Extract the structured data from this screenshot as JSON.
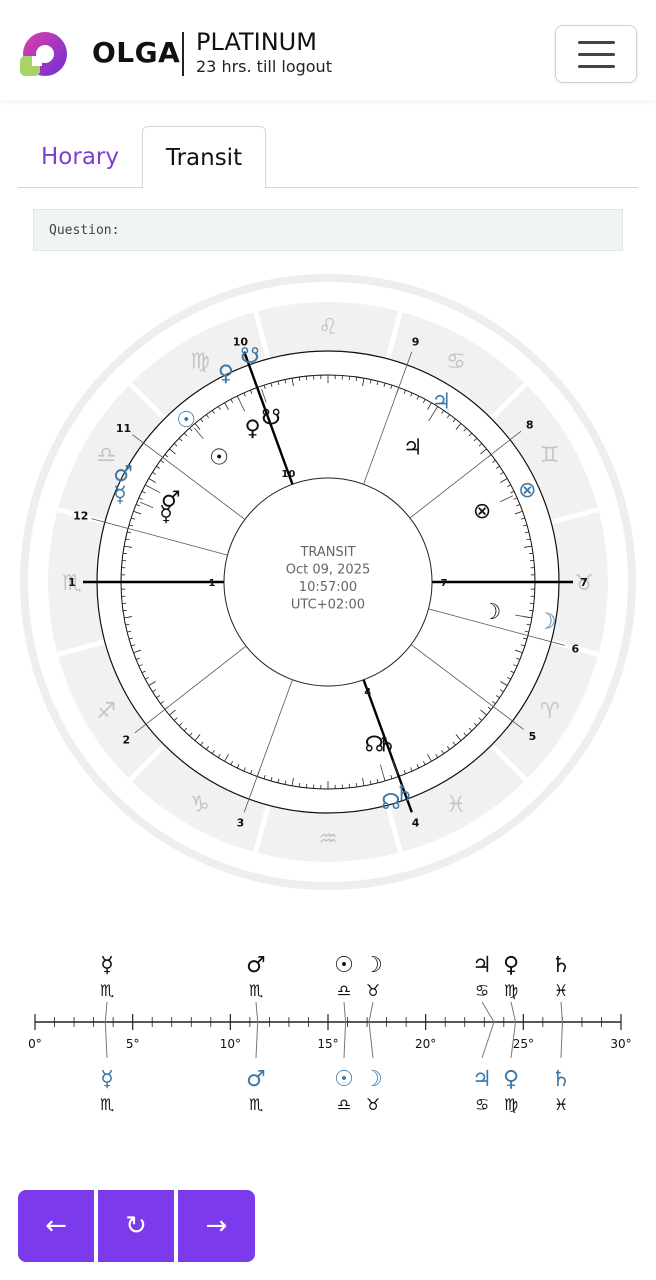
{
  "header": {
    "brand": "OLGA",
    "plan": "PLATINUM",
    "logout_text": "23 hrs. till logout",
    "menu_icon": "hamburger-menu-icon",
    "accent_color": "#7c3aed"
  },
  "tabs": [
    {
      "label": "Horary",
      "active": false
    },
    {
      "label": "Transit",
      "active": true
    }
  ],
  "question": {
    "label": "Question:"
  },
  "chart": {
    "center_lines": [
      "TRANSIT",
      "Oct 09, 2025",
      "10:57:00",
      "UTC+02:00"
    ],
    "zodiac_signs": [
      "♍",
      "♌",
      "♋",
      "♊",
      "♉",
      "♈",
      "♓",
      "♒",
      "♑",
      "♐",
      "♏",
      "♎"
    ],
    "inner_house_labels": [
      "1",
      "2",
      "3",
      "4",
      "5",
      "6",
      "7",
      "8",
      "9",
      "10",
      "11",
      "12"
    ],
    "outer_house_labels": [
      "1",
      "4",
      "7",
      "10"
    ],
    "natal_planets": [
      "☿",
      "♂",
      "☉",
      "♀",
      "☋",
      "♃",
      "⊗",
      "☽",
      "♄",
      "☊"
    ],
    "transit_planets": [
      "☿",
      "♂",
      "☉",
      "♀",
      "☋",
      "♃",
      "⊗",
      "☽",
      "♄",
      "☊"
    ],
    "natal_color": "#111111",
    "transit_color": "#3d79a8"
  },
  "ruler": {
    "tick_labels": [
      "0°",
      "5°",
      "10°",
      "15°",
      "20°",
      "25°",
      "30°"
    ],
    "top_planets": [
      {
        "planet": "☿",
        "sign": "♏",
        "degree": 3.6
      },
      {
        "planet": "♂",
        "sign": "♏",
        "degree": 11.4
      },
      {
        "planet": "☉",
        "sign": "♎",
        "degree": 15.9
      },
      {
        "planet": "☽",
        "sign": "♉",
        "degree": 17.1
      },
      {
        "planet": "♃",
        "sign": "♋",
        "degree": 23.5
      },
      {
        "planet": "♀",
        "sign": "♍",
        "degree": 24.6
      },
      {
        "planet": "♄",
        "sign": "♓",
        "degree": 27.0
      }
    ],
    "bottom_planets": [
      {
        "planet": "☿",
        "sign": "♏",
        "degree": 3.6
      },
      {
        "planet": "♂",
        "sign": "♏",
        "degree": 11.4
      },
      {
        "planet": "☉",
        "sign": "♎",
        "degree": 15.9
      },
      {
        "planet": "☽",
        "sign": "♉",
        "degree": 17.1
      },
      {
        "planet": "♃",
        "sign": "♋",
        "degree": 23.5
      },
      {
        "planet": "♀",
        "sign": "♍",
        "degree": 24.6
      },
      {
        "planet": "♄",
        "sign": "♓",
        "degree": 27.0
      }
    ]
  },
  "navigation": {
    "prev_label": "←",
    "reset_label": "↻",
    "next_label": "→"
  }
}
